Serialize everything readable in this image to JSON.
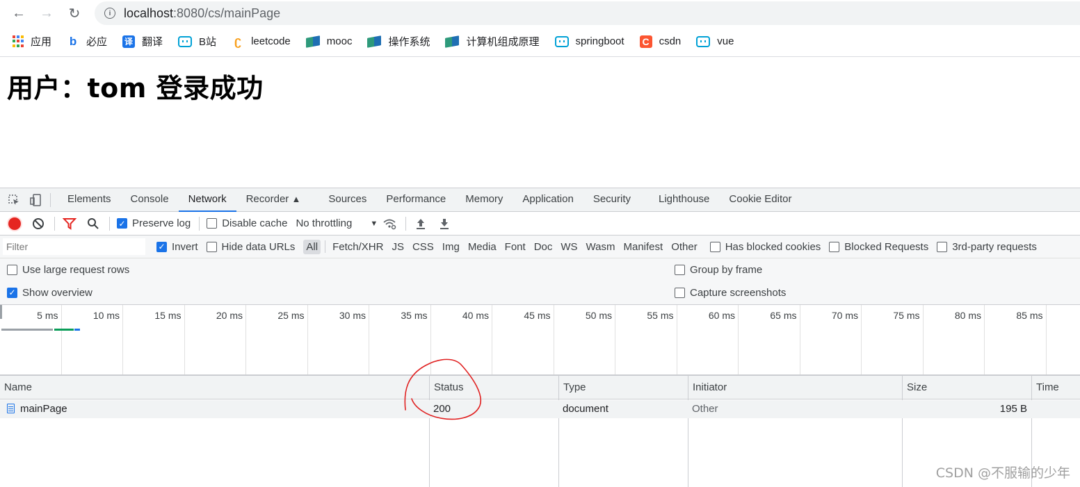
{
  "browser": {
    "url_host": "localhost",
    "url_port": ":8080",
    "url_path": "/cs/mainPage"
  },
  "bookmarks": [
    {
      "label": "应用",
      "icon": "apps-grid-icon"
    },
    {
      "label": "必应",
      "icon": "bing-icon"
    },
    {
      "label": "翻译",
      "icon": "translate-icon",
      "glyph": "译"
    },
    {
      "label": "B站",
      "icon": "bilibili-icon"
    },
    {
      "label": "leetcode",
      "icon": "leetcode-icon",
      "glyph": "ʗ"
    },
    {
      "label": "mooc",
      "icon": "book-icon"
    },
    {
      "label": "操作系统",
      "icon": "book-icon"
    },
    {
      "label": "计算机组成原理",
      "icon": "book-icon"
    },
    {
      "label": "springboot",
      "icon": "bilibili-icon"
    },
    {
      "label": "csdn",
      "icon": "csdn-icon",
      "glyph": "C"
    },
    {
      "label": "vue",
      "icon": "bilibili-icon"
    }
  ],
  "page": {
    "heading": "用户：tom 登录成功"
  },
  "devtools": {
    "tabs": [
      "Elements",
      "Console",
      "Network",
      "Recorder",
      "Sources",
      "Performance",
      "Memory",
      "Application",
      "Security",
      "Lighthouse",
      "Cookie Editor"
    ],
    "active_tab": "Network",
    "toolbar": {
      "preserve_log": "Preserve log",
      "disable_cache": "Disable cache",
      "throttling": "No throttling"
    },
    "filter": {
      "placeholder": "Filter",
      "invert": "Invert",
      "hide_data_urls": "Hide data URLs",
      "types": [
        "All",
        "Fetch/XHR",
        "JS",
        "CSS",
        "Img",
        "Media",
        "Font",
        "Doc",
        "WS",
        "Wasm",
        "Manifest",
        "Other"
      ],
      "has_blocked_cookies": "Has blocked cookies",
      "blocked_requests": "Blocked Requests",
      "third_party": "3rd-party requests"
    },
    "options": {
      "large_rows": "Use large request rows",
      "group_by_frame": "Group by frame",
      "show_overview": "Show overview",
      "capture_screenshots": "Capture screenshots"
    },
    "timeline_ticks": [
      "5 ms",
      "10 ms",
      "15 ms",
      "20 ms",
      "25 ms",
      "30 ms",
      "35 ms",
      "40 ms",
      "45 ms",
      "50 ms",
      "55 ms",
      "60 ms",
      "65 ms",
      "70 ms",
      "75 ms",
      "80 ms",
      "85 ms"
    ],
    "table": {
      "columns": [
        "Name",
        "Status",
        "Type",
        "Initiator",
        "Size",
        "Time"
      ],
      "rows": [
        {
          "name": "mainPage",
          "status": "200",
          "type": "document",
          "initiator": "Other",
          "size": "195 B",
          "time": ""
        }
      ]
    }
  },
  "watermark": "CSDN @不服输的少年"
}
